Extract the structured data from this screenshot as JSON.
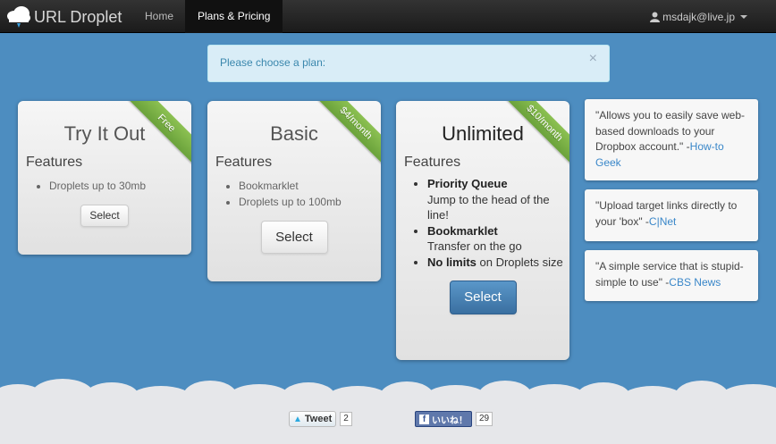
{
  "navbar": {
    "brand": "URL Droplet",
    "items": [
      {
        "label": "Home"
      },
      {
        "label": "Plans & Pricing"
      }
    ],
    "user": "msdajk@live.jp"
  },
  "alert": {
    "message": "Please choose a plan:",
    "close": "×"
  },
  "plans": [
    {
      "title": "Try It Out",
      "ribbon": "Free",
      "features_label": "Features",
      "features": [
        "Droplets up to 30mb"
      ],
      "button": "Select"
    },
    {
      "title": "Basic",
      "ribbon": "$4/month",
      "features_label": "Features",
      "features": [
        "Bookmarklet",
        "Droplets up to 100mb"
      ],
      "button": "Select"
    },
    {
      "title": "Unlimited",
      "ribbon": "$10/month",
      "features_label": "Features",
      "features": [
        {
          "bold": "Priority Queue",
          "text": "Jump to the head of the line!"
        },
        {
          "bold": "Bookmarklet",
          "text": "Transfer on the go"
        },
        {
          "bold": "No limits",
          "text": " on Droplets size"
        }
      ],
      "button": "Select"
    }
  ],
  "testimonials": [
    {
      "quote": "\"Allows you to easily save web-based downloads to your Dropbox account.\" -",
      "source": "How-to Geek"
    },
    {
      "quote": "\"Upload target links directly to your 'box\" -",
      "source": "C|Net"
    },
    {
      "quote": "\"A simple service that is stupid-simple to use\" -",
      "source": "CBS News"
    }
  ],
  "social": {
    "tweet_label": "Tweet",
    "tweet_count": "2",
    "fb_label": "いいね！",
    "fb_count": "29"
  },
  "colors": {
    "background": "#4d8dc0",
    "ribbon": "#7bb347",
    "primary_button": "#3a6fa0"
  }
}
